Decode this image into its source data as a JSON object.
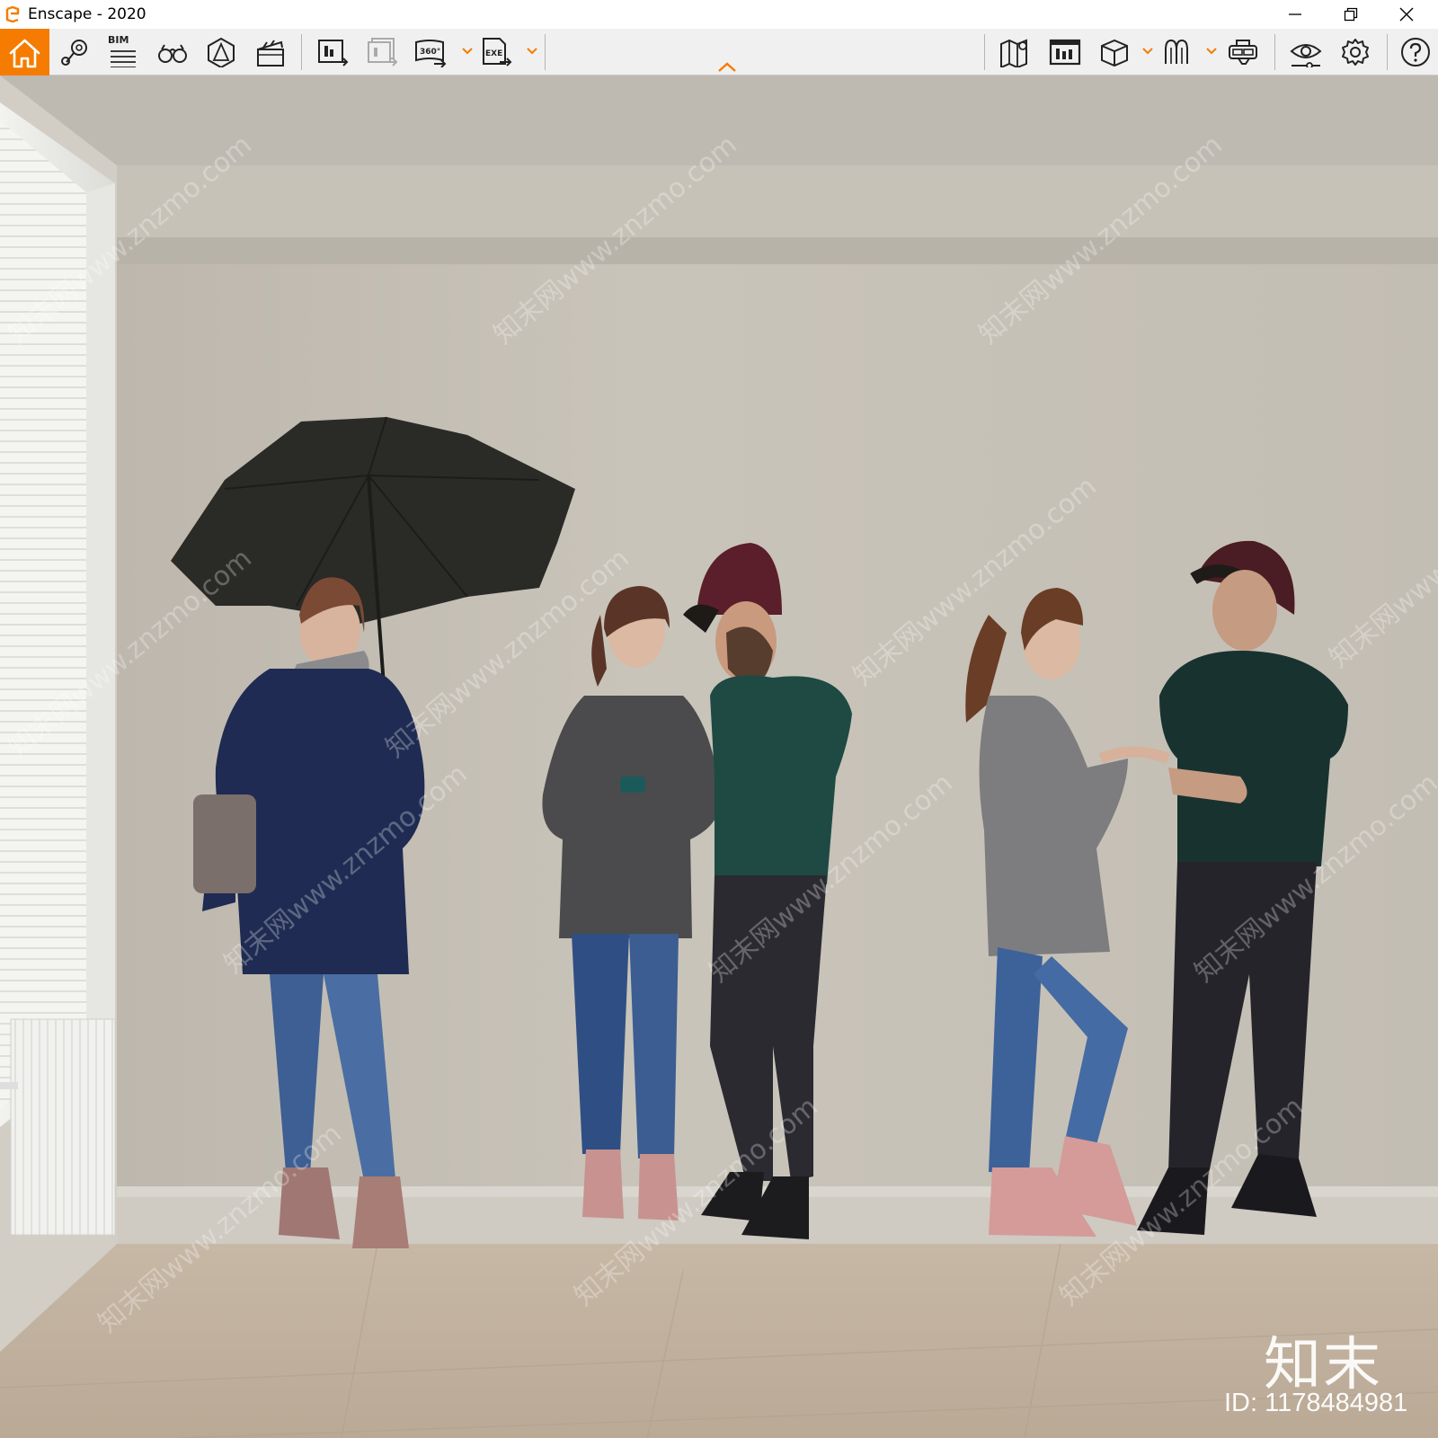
{
  "window": {
    "title": "Enscape - 2020"
  },
  "toolbar": {
    "bim_label": "BIM",
    "icons_left": [
      "home-icon",
      "location-pin-icon",
      "bim-list-icon",
      "binoculars-icon",
      "asset-library-icon",
      "clapperboard-icon",
      "render-screenshot-icon",
      "batch-render-icon",
      "panorama-360-icon",
      "export-exe-icon"
    ],
    "icons_right": [
      "map-icon",
      "video-editor-icon",
      "cube-icon",
      "sun-icon",
      "vr-headset-icon",
      "eye-icon",
      "settings-gear-icon",
      "help-icon"
    ],
    "accent_color": "#f57c00"
  },
  "viewport": {
    "watermark_logo": "知末",
    "watermark_id": "ID: 1178484981",
    "watermark_text": "知末网www.znzmo.com"
  }
}
